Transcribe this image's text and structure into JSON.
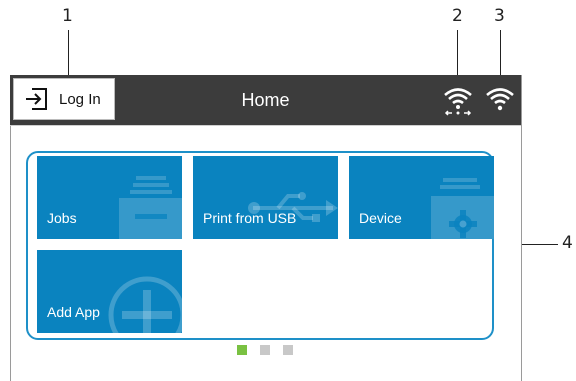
{
  "callouts": {
    "one": "1",
    "two": "2",
    "three": "3",
    "four": "4"
  },
  "header": {
    "login_label": "Log In",
    "title": "Home"
  },
  "tiles": [
    {
      "label": "Jobs",
      "icon": "printer-jobs-icon"
    },
    {
      "label": "Print from USB",
      "icon": "usb-icon"
    },
    {
      "label": "Device",
      "icon": "device-gear-icon"
    },
    {
      "label": "Add App",
      "icon": "plus-icon"
    }
  ],
  "pagination": {
    "pages": 3,
    "current": 1
  },
  "colors": {
    "header_bg": "#3c3c3c",
    "tile_bg": "#0a83bf",
    "frame": "#1e90c8",
    "dot_active": "#7ac142",
    "dot_inactive": "#c8c8c8"
  }
}
